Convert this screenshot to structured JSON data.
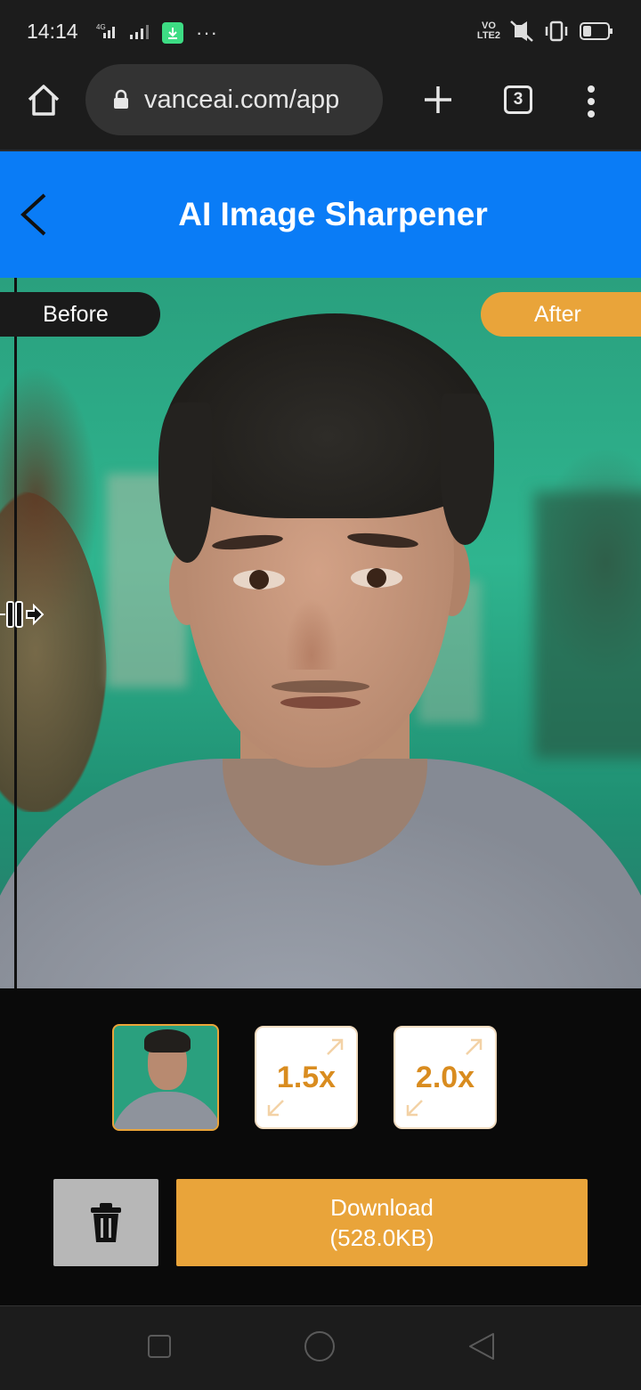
{
  "status_bar": {
    "time": "14:14",
    "network": "4G",
    "volte": [
      "VO",
      "LTE2"
    ],
    "more": "···",
    "icons": [
      "signal-icon",
      "download-icon",
      "mute-vibrate-icon",
      "vibrate-icon",
      "battery-icon"
    ]
  },
  "browser": {
    "url": "vanceai.com/app",
    "tab_count": "3",
    "icons": [
      "home-icon",
      "lock-icon",
      "plus-icon",
      "kebab-menu-icon"
    ]
  },
  "app_header": {
    "title": "AI Image Sharpener",
    "bg_color": "#0a7cf6"
  },
  "comparison": {
    "before_label": "Before",
    "after_label": "After"
  },
  "zoom_options": [
    {
      "label": "",
      "selected": true,
      "type": "thumbnail"
    },
    {
      "label": "1.5x",
      "selected": false
    },
    {
      "label": "2.0x",
      "selected": false
    }
  ],
  "actions": {
    "download_label": "Download",
    "download_size": "(528.0KB)",
    "accent_color": "#e9a43a"
  },
  "nav_bar": {
    "icons": [
      "recents-icon",
      "home-circle-icon",
      "back-triangle-icon"
    ]
  }
}
